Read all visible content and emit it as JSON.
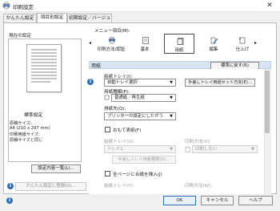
{
  "window": {
    "title": "印刷設定",
    "close_glyph": "✕"
  },
  "tabs": [
    {
      "label": "かんたん設定",
      "active": false
    },
    {
      "label": "項目別設定",
      "active": true
    },
    {
      "label": "初期設定／バージョン",
      "active": false
    }
  ],
  "left_panel": {
    "current_settings_label": "現在の設定",
    "preset_name": "標準設定",
    "info_lines": [
      "原稿サイズ:",
      "A4 (210 x 297 mm)",
      "印刷用紙サイズ:",
      "原稿サイズと同じ"
    ],
    "settings_list_button": "設定内容一覧(L)...",
    "register_button": "かんたん設定に登録(G)..."
  },
  "menu": {
    "label": "メニュー項目(M):",
    "items": [
      {
        "label": "印刷方法/認証",
        "icon": "print-method-icon",
        "selected": false
      },
      {
        "label": "基本",
        "icon": "basic-icon",
        "selected": false
      },
      {
        "label": "用紙",
        "icon": "paper-icon",
        "selected": true
      },
      {
        "label": "編集",
        "icon": "edit-icon",
        "selected": false
      },
      {
        "label": "仕上げ",
        "icon": "finishing-icon",
        "selected": false
      }
    ]
  },
  "section": {
    "title": "用紙",
    "restore_button": "標準に戻す(R)"
  },
  "fields": {
    "input_tray_label": "給紙トレイ(I):",
    "input_tray_value": "自動トレイ選択",
    "manual_tray_button": "手差しトレイ用紙セット方向(E)...",
    "paper_type_label": "用紙種類(P):",
    "paper_type_value": "普通紙／再生紙",
    "output_tray_label": "排紙先(Q):",
    "output_tray_value": "プリンターの設定にしたがう",
    "cover_checkbox_label": "おもて表紙(F)",
    "cover_tray_label": "給紙トレイ(U):",
    "cover_tray_value": "トレイ1",
    "cover_print_label": "印刷方法(V):",
    "cover_print_value": "印刷しない",
    "cover_manual_button": "手差しトレイ用紙種類(O)...",
    "slip_checkbox_label": "全ページに合紙を挿入(J)",
    "slip_tray_label": "給紙トレイ(Y):",
    "slip_print_label": "印刷方法(W):"
  },
  "footer": {
    "ok": "OK",
    "cancel": "キャンセル",
    "help": "ヘルプ"
  },
  "colors": {
    "accent": "#2d6db5",
    "section_bg": "#d8e4f2",
    "selected_menu_border": "#4a4a4a"
  }
}
